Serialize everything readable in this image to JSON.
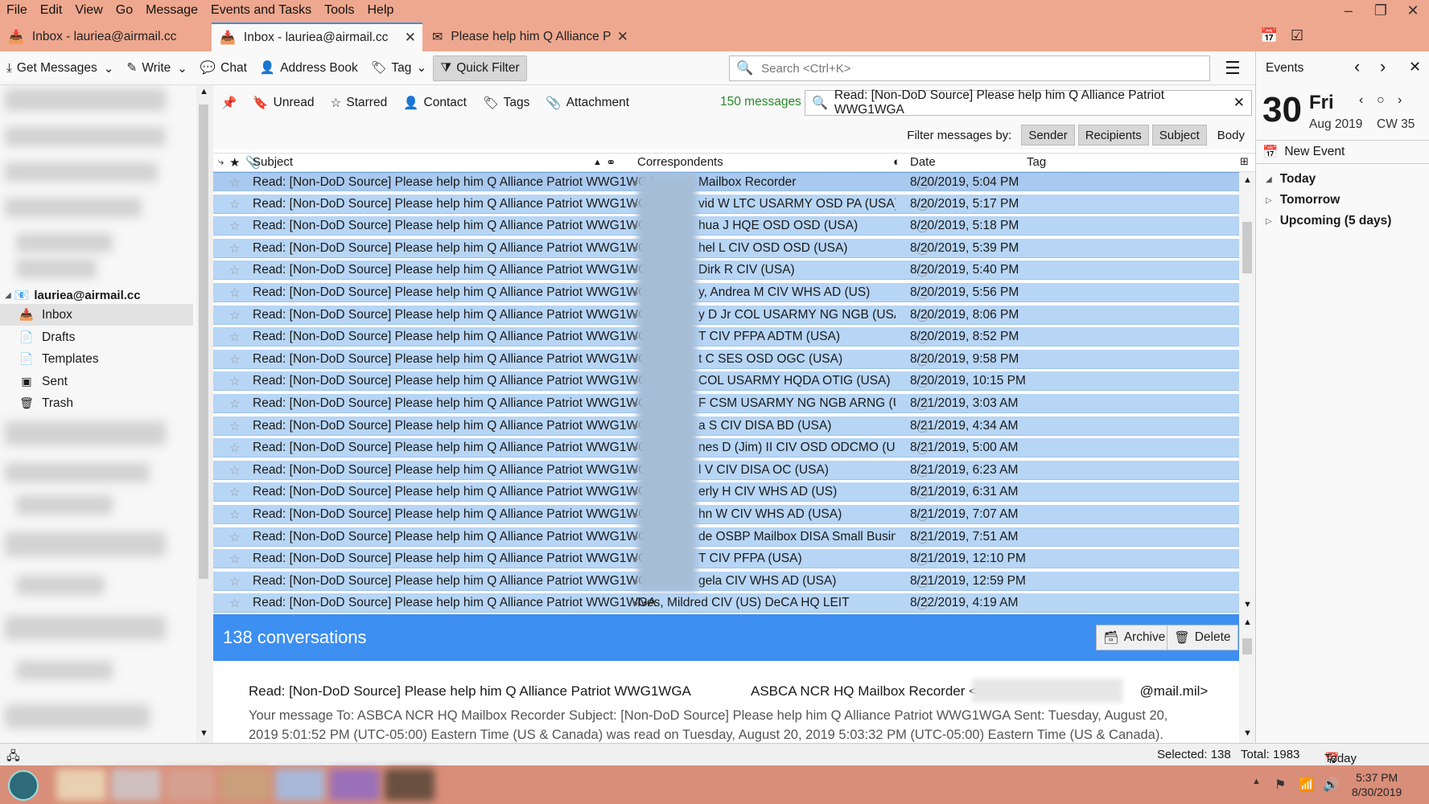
{
  "menu": [
    "File",
    "Edit",
    "View",
    "Go",
    "Message",
    "Events and Tasks",
    "Tools",
    "Help"
  ],
  "window_controls": {
    "minimize": "–",
    "maximize": "❐",
    "close": "✕"
  },
  "tabs": [
    {
      "label": "Inbox - lauriea@airmail.cc"
    },
    {
      "label": "Inbox - lauriea@airmail.cc"
    },
    {
      "label": "Please help him Q Alliance P"
    }
  ],
  "toolbar": {
    "get_messages": "Get Messages",
    "write": "Write",
    "chat": "Chat",
    "address_book": "Address Book",
    "tag": "Tag",
    "quick_filter": "Quick Filter",
    "search_placeholder": "Search <Ctrl+K>"
  },
  "sidebar": {
    "account": "lauriea@airmail.cc",
    "folders": [
      {
        "label": "Inbox"
      },
      {
        "label": "Drafts"
      },
      {
        "label": "Templates"
      },
      {
        "label": "Sent"
      },
      {
        "label": "Trash"
      }
    ]
  },
  "quickfilter": {
    "unread": "Unread",
    "starred": "Starred",
    "contact": "Contact",
    "tags": "Tags",
    "attachment": "Attachment",
    "count": "150 messages",
    "search_value": "Read: [Non-DoD Source] Please help him Q Alliance Patriot WWG1WGA",
    "filter_by": "Filter messages by:",
    "sender": "Sender",
    "recipients": "Recipients",
    "subject": "Subject",
    "body": "Body"
  },
  "columns": {
    "subject": "Subject",
    "correspondents": "Correspondents",
    "date": "Date",
    "tag": "Tag"
  },
  "messages": [
    {
      "subject": "Read: [Non-DoD Source] Please help him Q Alliance Patriot WWG1WGA",
      "corr": "Mailbox Recorder",
      "date": "8/20/2019, 5:04 PM"
    },
    {
      "subject": "Read: [Non-DoD Source] Please help him Q Alliance Patriot WWG1WGA",
      "corr": "vid W LTC USARMY OSD PA (USA)",
      "date": "8/20/2019, 5:17 PM"
    },
    {
      "subject": "Read: [Non-DoD Source] Please help him Q Alliance Patriot WWG1WGA",
      "corr": "hua J HQE OSD OSD (USA)",
      "date": "8/20/2019, 5:18 PM"
    },
    {
      "subject": "Read: [Non-DoD Source] Please help him Q Alliance Patriot WWG1WGA",
      "corr": "hel L CIV OSD OSD (USA)",
      "date": "8/20/2019, 5:39 PM"
    },
    {
      "subject": "Read: [Non-DoD Source] Please help him Q Alliance Patriot WWG1WGA",
      "corr": "Dirk R CIV (USA)",
      "date": "8/20/2019, 5:40 PM"
    },
    {
      "subject": "Read: [Non-DoD Source] Please help him Q Alliance Patriot WWG1WGA",
      "corr": "y, Andrea M CIV WHS AD (US)",
      "date": "8/20/2019, 5:56 PM"
    },
    {
      "subject": "Read: [Non-DoD Source] Please help him Q Alliance Patriot WWG1WGA",
      "corr": "y D Jr COL USARMY NG NGB (USA)",
      "date": "8/20/2019, 8:06 PM"
    },
    {
      "subject": "Read: [Non-DoD Source] Please help him Q Alliance Patriot WWG1WGA",
      "corr": "T CIV PFPA ADTM (USA)",
      "date": "8/20/2019, 8:52 PM"
    },
    {
      "subject": "Read: [Non-DoD Source] Please help him Q Alliance Patriot WWG1WGA",
      "corr": "t C SES OSD OGC (USA)",
      "date": "8/20/2019, 9:58 PM"
    },
    {
      "subject": "Read: [Non-DoD Source] Please help him Q Alliance Patriot WWG1WGA",
      "corr": "COL USARMY HQDA OTIG (USA)",
      "date": "8/20/2019, 10:15 PM"
    },
    {
      "subject": "Read: [Non-DoD Source] Please help him Q Alliance Patriot WWG1WGA",
      "corr": "F CSM USARMY NG NGB ARNG (USA)",
      "date": "8/21/2019, 3:03 AM"
    },
    {
      "subject": "Read: [Non-DoD Source] Please help him Q Alliance Patriot WWG1WGA",
      "corr": "a S CIV DISA BD (USA)",
      "date": "8/21/2019, 4:34 AM"
    },
    {
      "subject": "Read: [Non-DoD Source] Please help him Q Alliance Patriot WWG1WGA",
      "corr": "nes D (Jim) II CIV OSD ODCMO (USA)",
      "date": "8/21/2019, 5:00 AM"
    },
    {
      "subject": "Read: [Non-DoD Source] Please help him Q Alliance Patriot WWG1WGA",
      "corr": "l V CIV DISA OC (USA)",
      "date": "8/21/2019, 6:23 AM"
    },
    {
      "subject": "Read: [Non-DoD Source] Please help him Q Alliance Patriot WWG1WGA",
      "corr": "erly H CIV WHS AD (US)",
      "date": "8/21/2019, 6:31 AM"
    },
    {
      "subject": "Read: [Non-DoD Source] Please help him Q Alliance Patriot WWG1WGA",
      "corr": "hn W CIV WHS AD (USA)",
      "date": "8/21/2019, 7:07 AM"
    },
    {
      "subject": "Read: [Non-DoD Source] Please help him Q Alliance Patriot WWG1WGA",
      "corr": "de OSBP Mailbox DISA Small Business-...",
      "date": "8/21/2019, 7:51 AM"
    },
    {
      "subject": "Read: [Non-DoD Source] Please help him Q Alliance Patriot WWG1WGA",
      "corr": "T CIV PFPA (USA)",
      "date": "8/21/2019, 12:10 PM"
    },
    {
      "subject": "Read: [Non-DoD Source] Please help him Q Alliance Patriot WWG1WGA",
      "corr": "gela CIV WHS AD (USA)",
      "date": "8/21/2019, 12:59 PM"
    },
    {
      "subject": "Read: [Non-DoD Source] Please help him Q Alliance Patriot WWG1WGA",
      "corr": "Ives, Mildred CIV (US) DeCA HQ LEIT",
      "date": "8/22/2019, 4:19 AM"
    }
  ],
  "summary": {
    "conversations": "138 conversations",
    "archive": "Archive",
    "delete": "Delete"
  },
  "preview": {
    "subject": "Read: [Non-DoD Source] Please help him Q Alliance Patriot WWG1WGA",
    "from_prefix": "ASBCA NCR HQ Mailbox Recorder <a",
    "from_suffix": "@mail.mil>",
    "body": "Your message To: ASBCA NCR HQ Mailbox Recorder Subject: [Non-DoD Source] Please help him Q Alliance Patriot WWG1WGA Sent: Tuesday, August 20, 2019 5:01:52 PM (UTC-05:00) Eastern Time (US & Canada) was read on Tuesday, August 20, 2019 5:03:32 PM (UTC-05:00) Eastern Time (US & Canada)."
  },
  "events": {
    "title": "Events",
    "day": "30",
    "dow": "Fri",
    "month": "Aug 2019",
    "cw": "CW 35",
    "new_event": "New Event",
    "sections": [
      "Today",
      "Tomorrow",
      "Upcoming (5 days)"
    ]
  },
  "status": {
    "selected": "Selected: 138",
    "total": "Total: 1983",
    "today_pane": "Today Pane"
  },
  "taskbar": {
    "time": "5:37 PM",
    "date": "8/30/2019"
  },
  "colors": {
    "titlebar": "#eea88f",
    "selection": "#b7d5f5",
    "banner": "#3d8ff2",
    "count_green": "#2a8a2a"
  }
}
